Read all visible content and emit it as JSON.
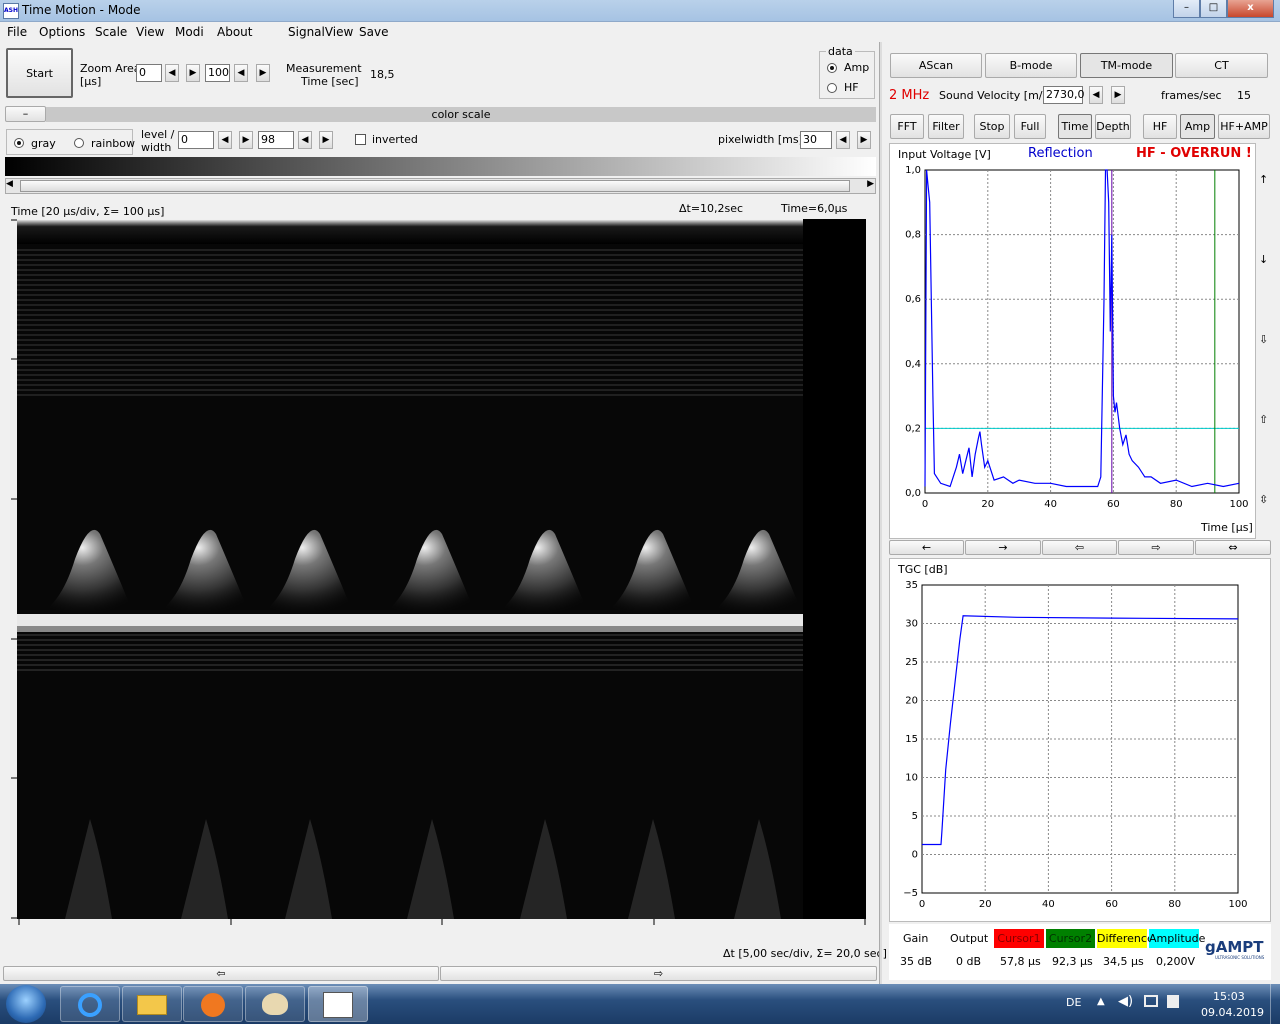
{
  "window": {
    "title": "Time Motion - Mode",
    "min": "–",
    "max": "□",
    "close": "x"
  },
  "menu": [
    "File",
    "Options",
    "Scale",
    "View",
    "Modi",
    "About",
    "SignalView",
    "Save"
  ],
  "controls": {
    "start": "Start",
    "zoom_label1": "Zoom Area",
    "zoom_label2": "[µs]",
    "zoom_from": "0",
    "zoom_to": "100",
    "meas_label1": "Measurement",
    "meas_label2": "Time [sec]",
    "meas_value": "18,5",
    "data_group": "data",
    "amp": "Amp",
    "hf": "HF",
    "minus": "–",
    "color_scale": "color scale",
    "gray": "gray",
    "rainbow": "rainbow",
    "level_label1": "level /",
    "level_label2": "width",
    "level": "0",
    "width": "98",
    "inverted": "inverted",
    "pixelwidth_label": "pixelwidth [ms]:",
    "pixelwidth": "30"
  },
  "tm_view": {
    "time_label": "Time   [20 µs/div, Σ= 100 µs]",
    "dt": "Δt=10,2sec",
    "time_val": "Time=6,0µs",
    "dt_axis": "Δt  [5,00 sec/div, Σ= 20,0 sec]",
    "scroll_left": "⇦",
    "scroll_right": "⇨"
  },
  "tabs": [
    "AScan",
    "B-mode",
    "TM-mode",
    "CT"
  ],
  "freq": "2 MHz",
  "sv_label": "Sound Velocity [m/s]",
  "sv_value": "2730,0",
  "fps_label": "frames/sec",
  "fps_value": "15",
  "mode_buttons": [
    "FFT",
    "Filter",
    "Stop",
    "Full",
    "Time",
    "Depth",
    "HF",
    "Amp",
    "HF+AMP"
  ],
  "ascan": {
    "ylabel": "Input Voltage [V]",
    "reflection": "Reflection",
    "overrun": "HF - OVERRUN !",
    "xlabel": "Time [µs]",
    "yticks": [
      "1,0",
      "0,8",
      "0,6",
      "0,4",
      "0,2",
      "0,0"
    ],
    "xticks": [
      "0",
      "20",
      "40",
      "60",
      "80",
      "100"
    ],
    "side": [
      "↑",
      "↓",
      "⇩",
      "⇧",
      "⇳"
    ],
    "bottom": [
      "←",
      "→",
      "⇦",
      "⇨",
      "⇔"
    ]
  },
  "chart_data": [
    {
      "type": "line",
      "ylabel": "Input Voltage [V]",
      "xlabel": "Time [µs]",
      "xlim": [
        0,
        100
      ],
      "ylim": [
        0,
        1
      ],
      "x": [
        0,
        0.5,
        1,
        1.5,
        2,
        2.5,
        3,
        5,
        8,
        10,
        11,
        12,
        13,
        14,
        15,
        16,
        17,
        17.5,
        18,
        19,
        20,
        22,
        25,
        28,
        30,
        35,
        40,
        45,
        50,
        55,
        56,
        57,
        57.5,
        58,
        58.5,
        59,
        59.5,
        60,
        60.5,
        61,
        62,
        63,
        64,
        65,
        66,
        68,
        70,
        72,
        75,
        80,
        85,
        90,
        95,
        100
      ],
      "series": [
        {
          "values": [
            0.02,
            1.0,
            0.95,
            0.9,
            0.6,
            0.3,
            0.06,
            0.03,
            0.02,
            0.08,
            0.12,
            0.06,
            0.1,
            0.14,
            0.05,
            0.12,
            0.17,
            0.19,
            0.15,
            0.08,
            0.1,
            0.04,
            0.05,
            0.03,
            0.04,
            0.03,
            0.03,
            0.02,
            0.02,
            0.02,
            0.05,
            0.6,
            1.0,
            1.0,
            0.9,
            0.5,
            0.8,
            0.3,
            0.25,
            0.28,
            0.2,
            0.15,
            0.18,
            0.12,
            0.1,
            0.08,
            0.05,
            0.05,
            0.03,
            0.04,
            0.02,
            0.03,
            0.02,
            0.03
          ]
        }
      ],
      "hline": 0.2,
      "cursor_blue": 59.5,
      "cursor_green": 92.3
    },
    {
      "type": "line",
      "ylabel": "TGC [dB]",
      "xlim": [
        0,
        100
      ],
      "ylim": [
        -5,
        35
      ],
      "yticks": [
        "35",
        "30",
        "25",
        "20",
        "15",
        "10",
        "5",
        "0",
        "−5"
      ],
      "xticks": [
        "0",
        "20",
        "40",
        "60",
        "80",
        "100"
      ],
      "x": [
        0,
        6,
        6.3,
        7.5,
        9,
        12,
        13,
        30,
        60,
        100
      ],
      "series": [
        {
          "values": [
            1.3,
            1.3,
            3,
            11,
            17,
            28,
            31,
            30.8,
            30.7,
            30.6
          ]
        }
      ]
    }
  ],
  "tgc": {
    "ylabel": "TGC [dB]"
  },
  "footer": {
    "gain_label": "Gain",
    "gain": "35 dB",
    "output_label": "Output",
    "output": "0 dB",
    "cursor1_label": "Cursor1",
    "cursor1": "57,8 µs",
    "cursor2_label": "Cursor2",
    "cursor2": "92,3 µs",
    "diff_label": "Difference",
    "diff": "34,5 µs",
    "amp_label": "Amplitude",
    "amp": "0,200V",
    "logo": "gAMPT",
    "logo_sub": "ULTRASONIC SOLUTIONS",
    "c1_color": "#ff0000",
    "c2_color": "#008000",
    "diff_color": "#ffff00",
    "amp_color": "#00ffff"
  },
  "taskbar": {
    "lang": "DE",
    "time": "15:03",
    "date": "09.04.2019"
  }
}
